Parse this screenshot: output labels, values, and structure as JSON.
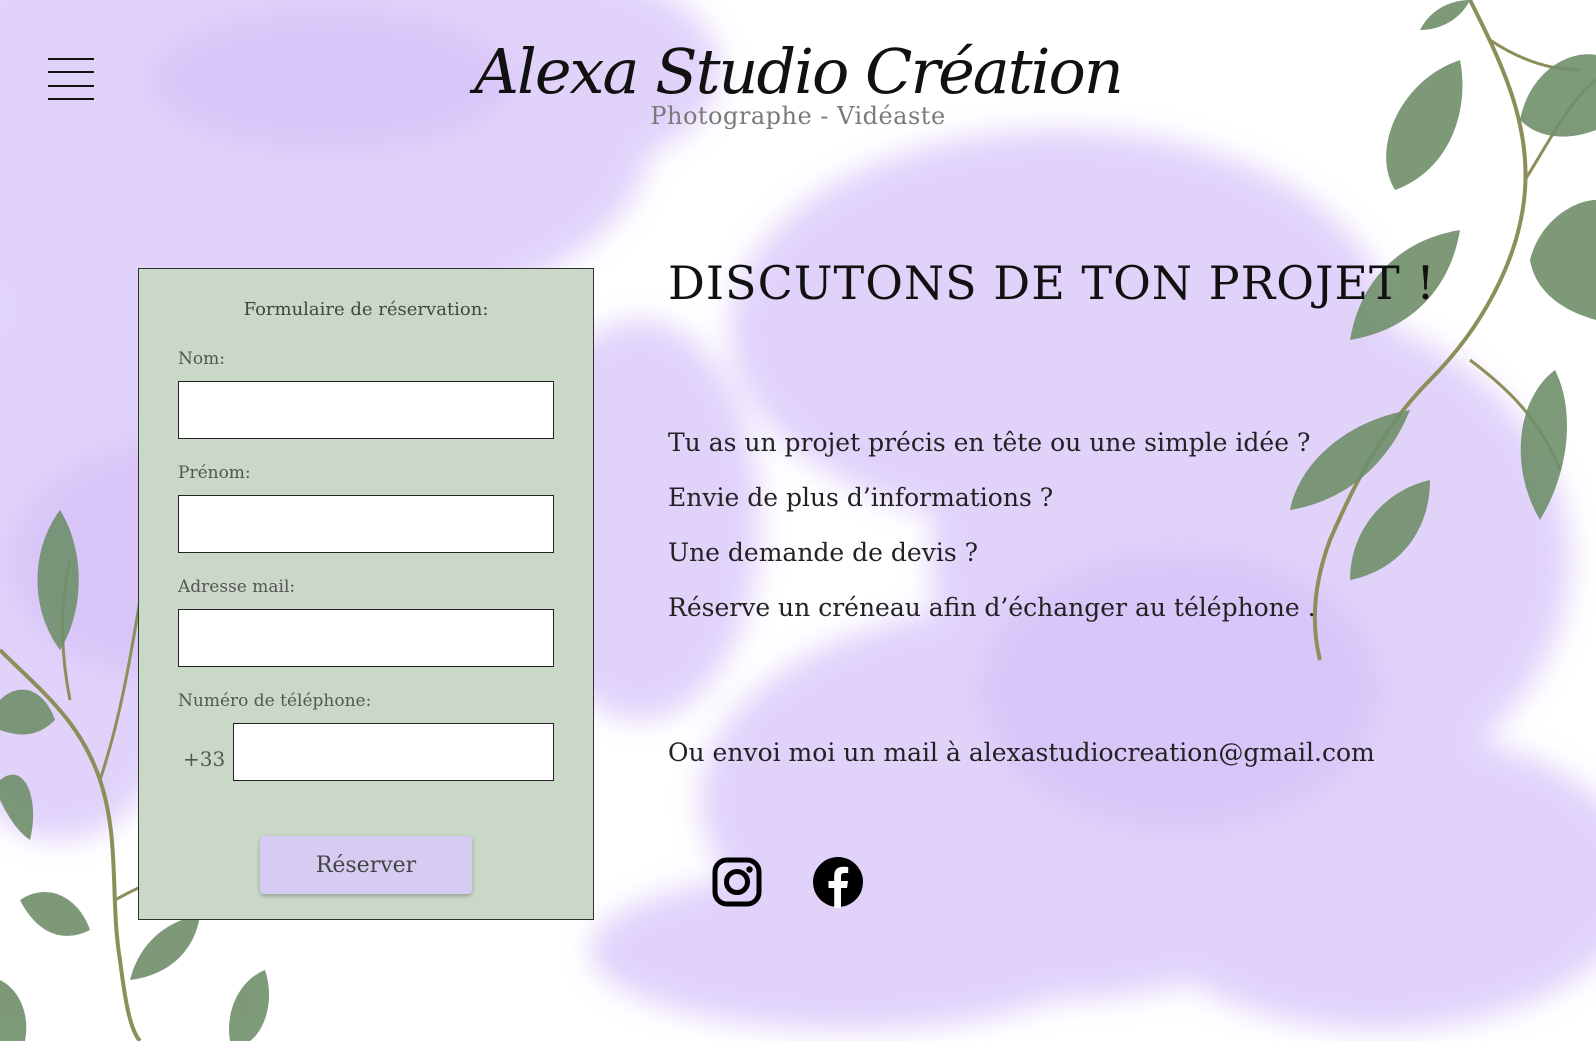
{
  "header": {
    "brand_title": "Alexa Studio Création",
    "brand_subtitle": "Photographe - Vidéaste",
    "menu_icon": "hamburger-menu-icon"
  },
  "form": {
    "title": "Formulaire de réservation:",
    "fields": {
      "nom": {
        "label": "Nom:",
        "value": ""
      },
      "prenom": {
        "label": "Prénom:",
        "value": ""
      },
      "email": {
        "label": "Adresse mail:",
        "value": ""
      },
      "phone": {
        "label": "Numéro de téléphone:",
        "prefix": "+33",
        "value": ""
      }
    },
    "submit_label": "Réserver"
  },
  "content": {
    "headline": "DISCUTONS DE TON PROJET !",
    "lines": [
      "Tu as un projet précis en tête ou une simple idée ?",
      "Envie de plus d’informations ?",
      "Une demande de devis ?",
      "Réserve un créneau afin d’échanger au téléphone ."
    ],
    "mail_prefix": "Ou envoi moi un mail à ",
    "mail_address": "alexastudiocreation@gmail.com"
  },
  "social": {
    "items": [
      "instagram-icon",
      "facebook-icon"
    ]
  },
  "colors": {
    "form_background": "#cad8c8",
    "button_background": "#d6ccf2",
    "watercolor": "#d8c8f8",
    "leaf": "#6f8f6a"
  }
}
